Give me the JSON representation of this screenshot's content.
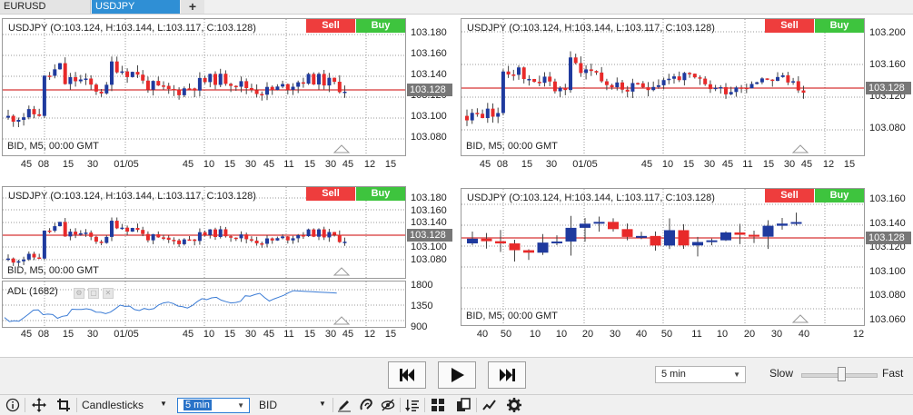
{
  "tabs": [
    {
      "label": "EURUSD",
      "active": false
    },
    {
      "label": "USDJPY",
      "active": true
    },
    {
      "label": "+",
      "active": false
    }
  ],
  "chart": {
    "symbol_text": "USDJPY (O:103.124, H:103.144, L:103.117, C:103.128)",
    "sell_label": "Sell",
    "buy_label": "Buy",
    "info_text": "BID, M5, 00:00 GMT",
    "current_price": "103.128",
    "bull_color": "#1f3a9e",
    "bear_color": "#e82a2a",
    "price_line_color": "#cc0000"
  },
  "panes": {
    "p1": {
      "y_ticks": [
        "103.180",
        "103.160",
        "103.140",
        "103.120",
        "103.100",
        "103.080"
      ],
      "x_ticks": [
        "45",
        "08",
        "15",
        "30",
        "01/05",
        "45",
        "10",
        "15",
        "30",
        "45",
        "11",
        "15",
        "30",
        "45",
        "12",
        "15"
      ]
    },
    "p2": {
      "y_ticks": [
        "103.200",
        "103.160",
        "103.120",
        "103.080"
      ],
      "x_ticks": [
        "45",
        "08",
        "15",
        "30",
        "01/05",
        "45",
        "10",
        "15",
        "30",
        "45",
        "11",
        "15",
        "30",
        "45",
        "12",
        "15"
      ]
    },
    "p3": {
      "y_ticks": [
        "103.180",
        "103.160",
        "103.140",
        "103.120",
        "103.100",
        "103.080"
      ]
    },
    "p4": {
      "y_ticks": [
        "103.160",
        "103.140",
        "103.120",
        "103.100",
        "103.080",
        "103.060"
      ],
      "x_ticks": [
        "40",
        "50",
        "10",
        "10",
        "20",
        "30",
        "40",
        "50",
        "11",
        "10",
        "20",
        "30",
        "40",
        "12"
      ]
    },
    "adl": {
      "label": "ADL (1682)",
      "y_ticks": [
        "1800",
        "1350",
        "900"
      ],
      "x_ticks": [
        "45",
        "08",
        "15",
        "30",
        "01/05",
        "45",
        "10",
        "15",
        "30",
        "45",
        "11",
        "15",
        "30",
        "45",
        "12",
        "15"
      ]
    }
  },
  "playback": {
    "timeframe": "5 min",
    "slow_label": "Slow",
    "fast_label": "Fast",
    "speed": 0.55
  },
  "toolbar": {
    "chart_type": "Candlesticks",
    "timeframe": "5 min",
    "price_type": "BID"
  },
  "icons": [
    "info-icon",
    "crosshair-icon",
    "crop-icon",
    "pencil-icon",
    "magnet-icon",
    "eye-hidden-icon",
    "sort-icon",
    "grid-icon",
    "copy-icon",
    "indicator-icon",
    "gear-icon"
  ]
}
